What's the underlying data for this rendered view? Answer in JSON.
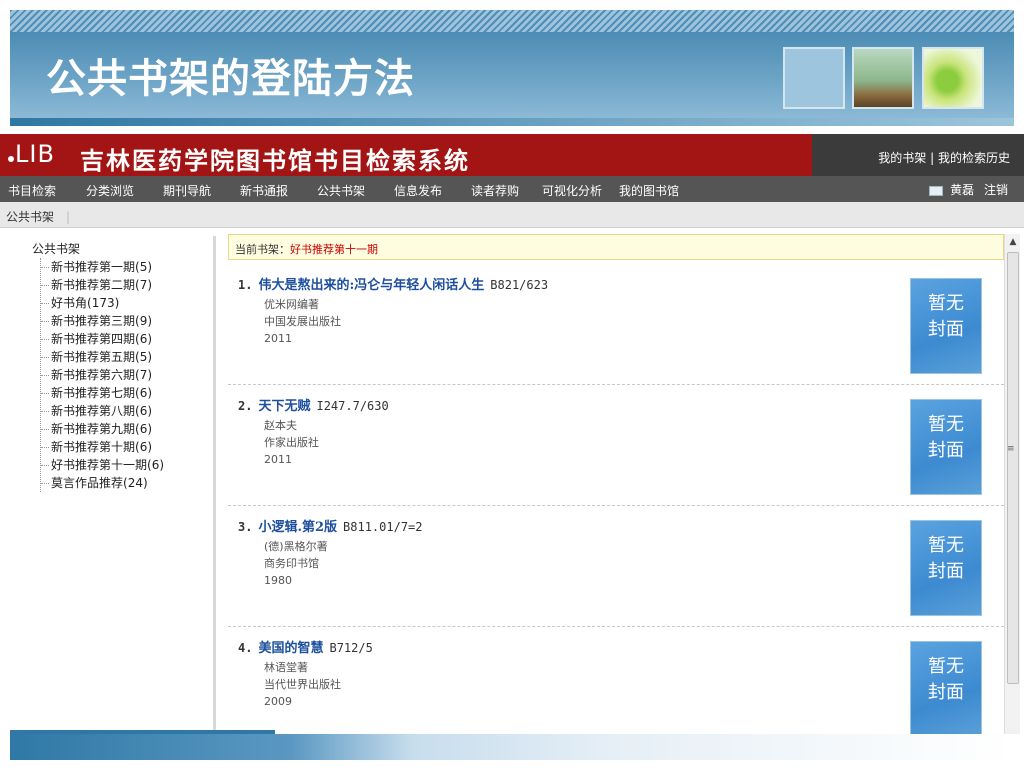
{
  "slide": {
    "title": "公共书架的登陆方法"
  },
  "app": {
    "logo": "LIB",
    "system_title": "吉林医药学院图书馆书目检索系统",
    "header_links": [
      "我的书架",
      "我的检索历史"
    ],
    "nav": [
      "书目检索",
      "分类浏览",
      "期刊导航",
      "新书通报",
      "公共书架",
      "信息发布",
      "读者荐购",
      "可视化分析",
      "我的图书馆"
    ],
    "user": {
      "name": "黄磊",
      "logout": "注销"
    },
    "breadcrumb": "公共书架",
    "shelf_tree": {
      "root": "公共书架",
      "items": [
        {
          "name": "新书推荐第一期",
          "count": "(5)"
        },
        {
          "name": "新书推荐第二期",
          "count": "(7)"
        },
        {
          "name": "好书角",
          "count": "(173)"
        },
        {
          "name": "新书推荐第三期",
          "count": "(9)"
        },
        {
          "name": "新书推荐第四期",
          "count": "(6)"
        },
        {
          "name": "新书推荐第五期",
          "count": "(5)"
        },
        {
          "name": "新书推荐第六期",
          "count": "(7)"
        },
        {
          "name": "新书推荐第七期",
          "count": "(6)"
        },
        {
          "name": "新书推荐第八期",
          "count": "(6)"
        },
        {
          "name": "新书推荐第九期",
          "count": "(6)"
        },
        {
          "name": "新书推荐第十期",
          "count": "(6)"
        },
        {
          "name": "好书推荐第十一期",
          "count": "(6)"
        },
        {
          "name": "莫言作品推荐",
          "count": "(24)"
        }
      ]
    },
    "current_shelf": {
      "label": "当前书架：",
      "name": "好书推荐第十一期"
    },
    "books": [
      {
        "num": "1.",
        "title": "伟大是熬出来的:冯仑与年轻人闲话人生",
        "call": "B821/623",
        "author": "优米网编著",
        "publisher": "中国发展出版社",
        "year": "2011",
        "cover": "暂无封面"
      },
      {
        "num": "2.",
        "title": "天下无贼",
        "call": "I247.7/630",
        "author": "赵本夫",
        "publisher": "作家出版社",
        "year": "2011",
        "cover": "暂无封面"
      },
      {
        "num": "3.",
        "title": "小逻辑.第2版",
        "call": "B811.01/7=2",
        "author": "(德)黑格尔著",
        "publisher": "商务印书馆",
        "year": "1980",
        "cover": "暂无封面"
      },
      {
        "num": "4.",
        "title": "美国的智慧",
        "call": "B712/5",
        "author": "林语堂著",
        "publisher": "当代世界出版社",
        "year": "2009",
        "cover": "暂无封面"
      }
    ]
  }
}
